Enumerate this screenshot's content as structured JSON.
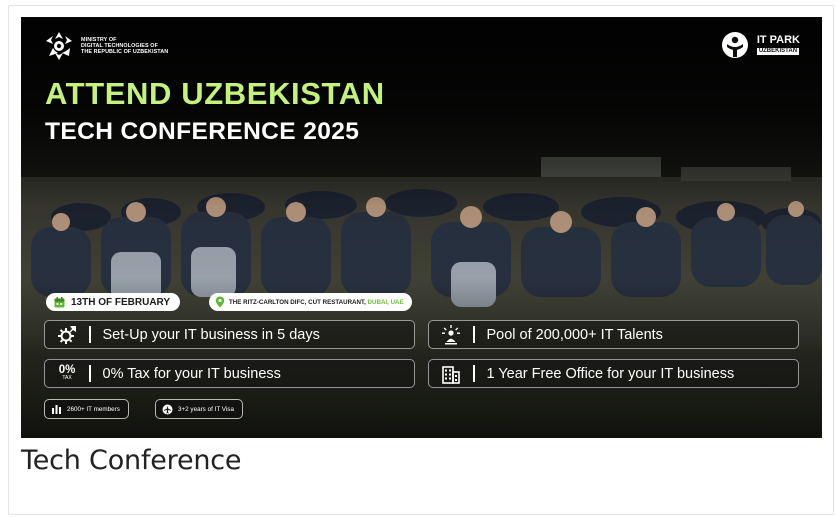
{
  "ministry": {
    "lines": "MINISTRY OF\nDIGITAL TECHNOLOGIES OF\nTHE REPUBLIC OF UZBEKISTAN",
    "icon": "ministry-emblem-icon"
  },
  "brand": {
    "name": "IT PARK",
    "country": "UZBEKISTAN",
    "icon": "it-park-logo-icon"
  },
  "headline": {
    "line1": "ATTEND UZBEKISTAN",
    "line2": "TECH CONFERENCE 2025"
  },
  "event": {
    "date": "13TH OF FEBRUARY",
    "venue": "THE RITZ-CARLTON DIFC, CUT RESTAURANT,",
    "city": "DUBAI, UAE"
  },
  "features": [
    {
      "label": "Set-Up your IT business in 5 days",
      "icon": "gear-rocket-icon"
    },
    {
      "label": "Pool of 200,000+ IT Talents",
      "icon": "talent-person-icon"
    },
    {
      "label": "0% Tax for your IT business",
      "icon": "tax-icon",
      "icon_text": "0%",
      "icon_subtext": "TAX"
    },
    {
      "label": "1 Year Free Office for your IT business",
      "icon": "office-building-icon"
    }
  ],
  "badges": [
    {
      "label": "2600+ IT members",
      "icon": "members-icon"
    },
    {
      "label": "3+2 years of IT Visa",
      "icon": "plane-icon"
    }
  ],
  "caption": "Tech Conference",
  "colors": {
    "headline_accent": "#c4f27a",
    "city_accent": "#6fbf3a",
    "pin_accent": "#5cb82e"
  }
}
